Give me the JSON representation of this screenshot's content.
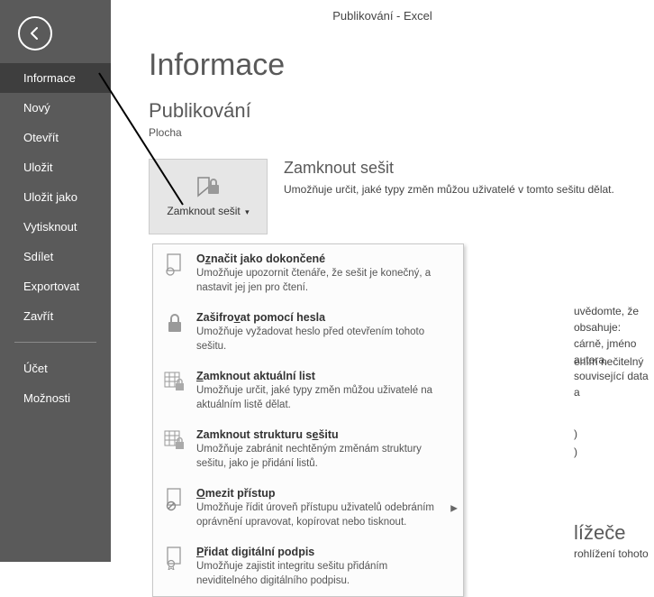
{
  "app_title": "Publikování - Excel",
  "page_title": "Informace",
  "doc_title": "Publikování",
  "doc_location": "Plocha",
  "sidebar": {
    "items": [
      {
        "label": "Informace"
      },
      {
        "label": "Nový"
      },
      {
        "label": "Otevřít"
      },
      {
        "label": "Uložit"
      },
      {
        "label": "Uložit jako"
      },
      {
        "label": "Vytisknout"
      },
      {
        "label": "Sdílet"
      },
      {
        "label": "Exportovat"
      },
      {
        "label": "Zavřít"
      }
    ],
    "footer": [
      {
        "label": "Účet"
      },
      {
        "label": "Možnosti"
      }
    ]
  },
  "protect_button": "Zamknout sešit",
  "protect_button_arrow": "▾",
  "protect_section": {
    "heading": "Zamknout sešit",
    "desc": "Umožňuje určit, jaké typy změn můžou uživatelé v tomto sešitu dělat."
  },
  "dropdown": [
    {
      "title_pre": "O",
      "title_u": "z",
      "title_post": "načit jako dokončené",
      "desc": "Umožňuje upozornit čtenáře, že sešit je konečný, a nastavit jej jen pro čtení."
    },
    {
      "title_pre": "Zašifro",
      "title_u": "v",
      "title_post": "at pomocí hesla",
      "desc": "Umožňuje vyžadovat heslo před otevřením tohoto sešitu."
    },
    {
      "title_pre": "",
      "title_u": "Z",
      "title_post": "amknout aktuální list",
      "desc": "Umožňuje určit, jaké typy změn můžou uživatelé na aktuálním listě dělat."
    },
    {
      "title_pre": "Zamknout strukturu s",
      "title_u": "e",
      "title_post": "šitu",
      "desc": "Umožňuje zabránit nechtěným změnám struktury sešitu, jako je přidání listů."
    },
    {
      "title_pre": "",
      "title_u": "O",
      "title_post": "mezit přístup",
      "desc": "Umožňuje řídit úroveň přístupu uživatelů odebráním oprávnění upravovat, kopírovat nebo tisknout.",
      "has_arrow": true
    },
    {
      "title_pre": "",
      "title_u": "P",
      "title_post": "řidat digitální podpis",
      "desc": "Umožňuje zajistit integritu sešitu přidáním neviditelného digitálního podpisu."
    }
  ],
  "bg": {
    "line1a": "uvědomte, že obsahuje:",
    "line1b": "cárně, jméno autora, související data a",
    "line2": "ením nečitelný",
    "line3": ")",
    "line4": ")",
    "line5": "lížeče",
    "line6": "rohlížení tohoto sešitu na webu."
  }
}
